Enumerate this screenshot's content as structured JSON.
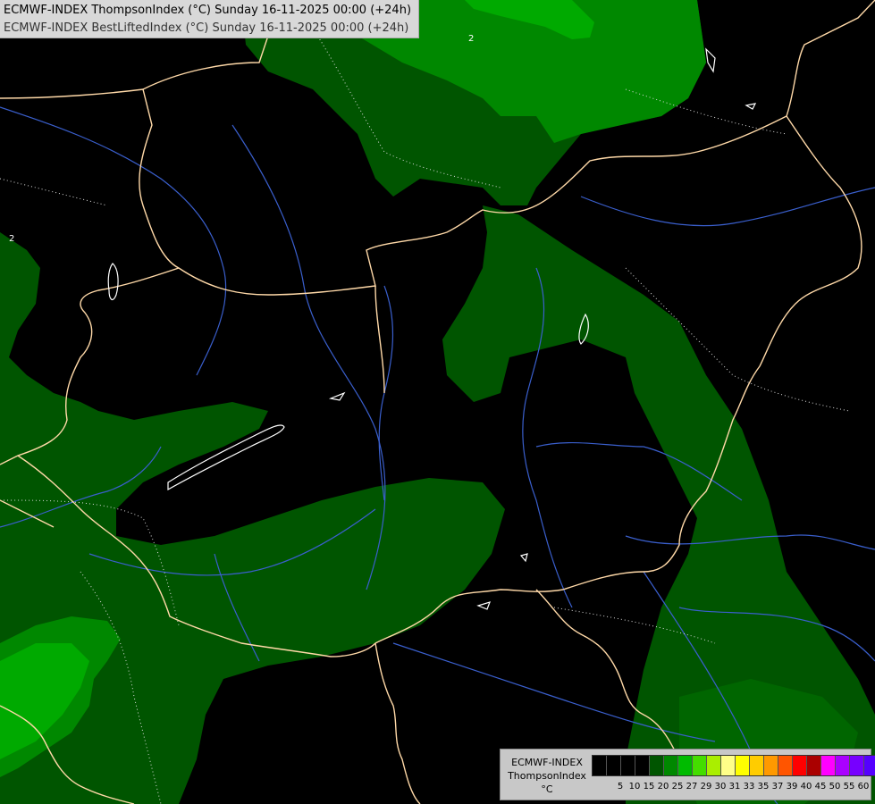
{
  "header": {
    "line1": "ECMWF-INDEX ThompsonIndex (°C) Sunday 16-11-2025 00:00 (+24h)",
    "line2": "ECMWF-INDEX BestLiftedIndex (°C) Sunday 16-11-2025 00:00 (+24h)"
  },
  "legend": {
    "title1": "ECMWF-INDEX",
    "title2": "ThompsonIndex",
    "unit": "°C",
    "colors": [
      "#000000",
      "#000000",
      "#000000",
      "#000000",
      "#005500",
      "#008800",
      "#00bb00",
      "#44dd00",
      "#aaee00",
      "#ffff88",
      "#ffff00",
      "#ffcc00",
      "#ff9900",
      "#ff5500",
      "#ff0000",
      "#aa0000",
      "#ff00ff",
      "#aa00ff",
      "#7700ff",
      "#5500ff",
      "#0000ff"
    ],
    "tick_labels": [
      "5",
      "10",
      "15",
      "20",
      "25",
      "27",
      "29",
      "30",
      "31",
      "33",
      "35",
      "37",
      "39",
      "40",
      "45",
      "50",
      "55",
      "60"
    ]
  },
  "map": {
    "colors": {
      "background": "#000000",
      "dark_green": "#005500",
      "mid_green": "#008800",
      "bright_green": "#00aa00",
      "border": "#ffd9a8",
      "river": "#3a5fcd",
      "contour": "#ffffff"
    },
    "contour_labels": [
      "2",
      "2"
    ]
  }
}
